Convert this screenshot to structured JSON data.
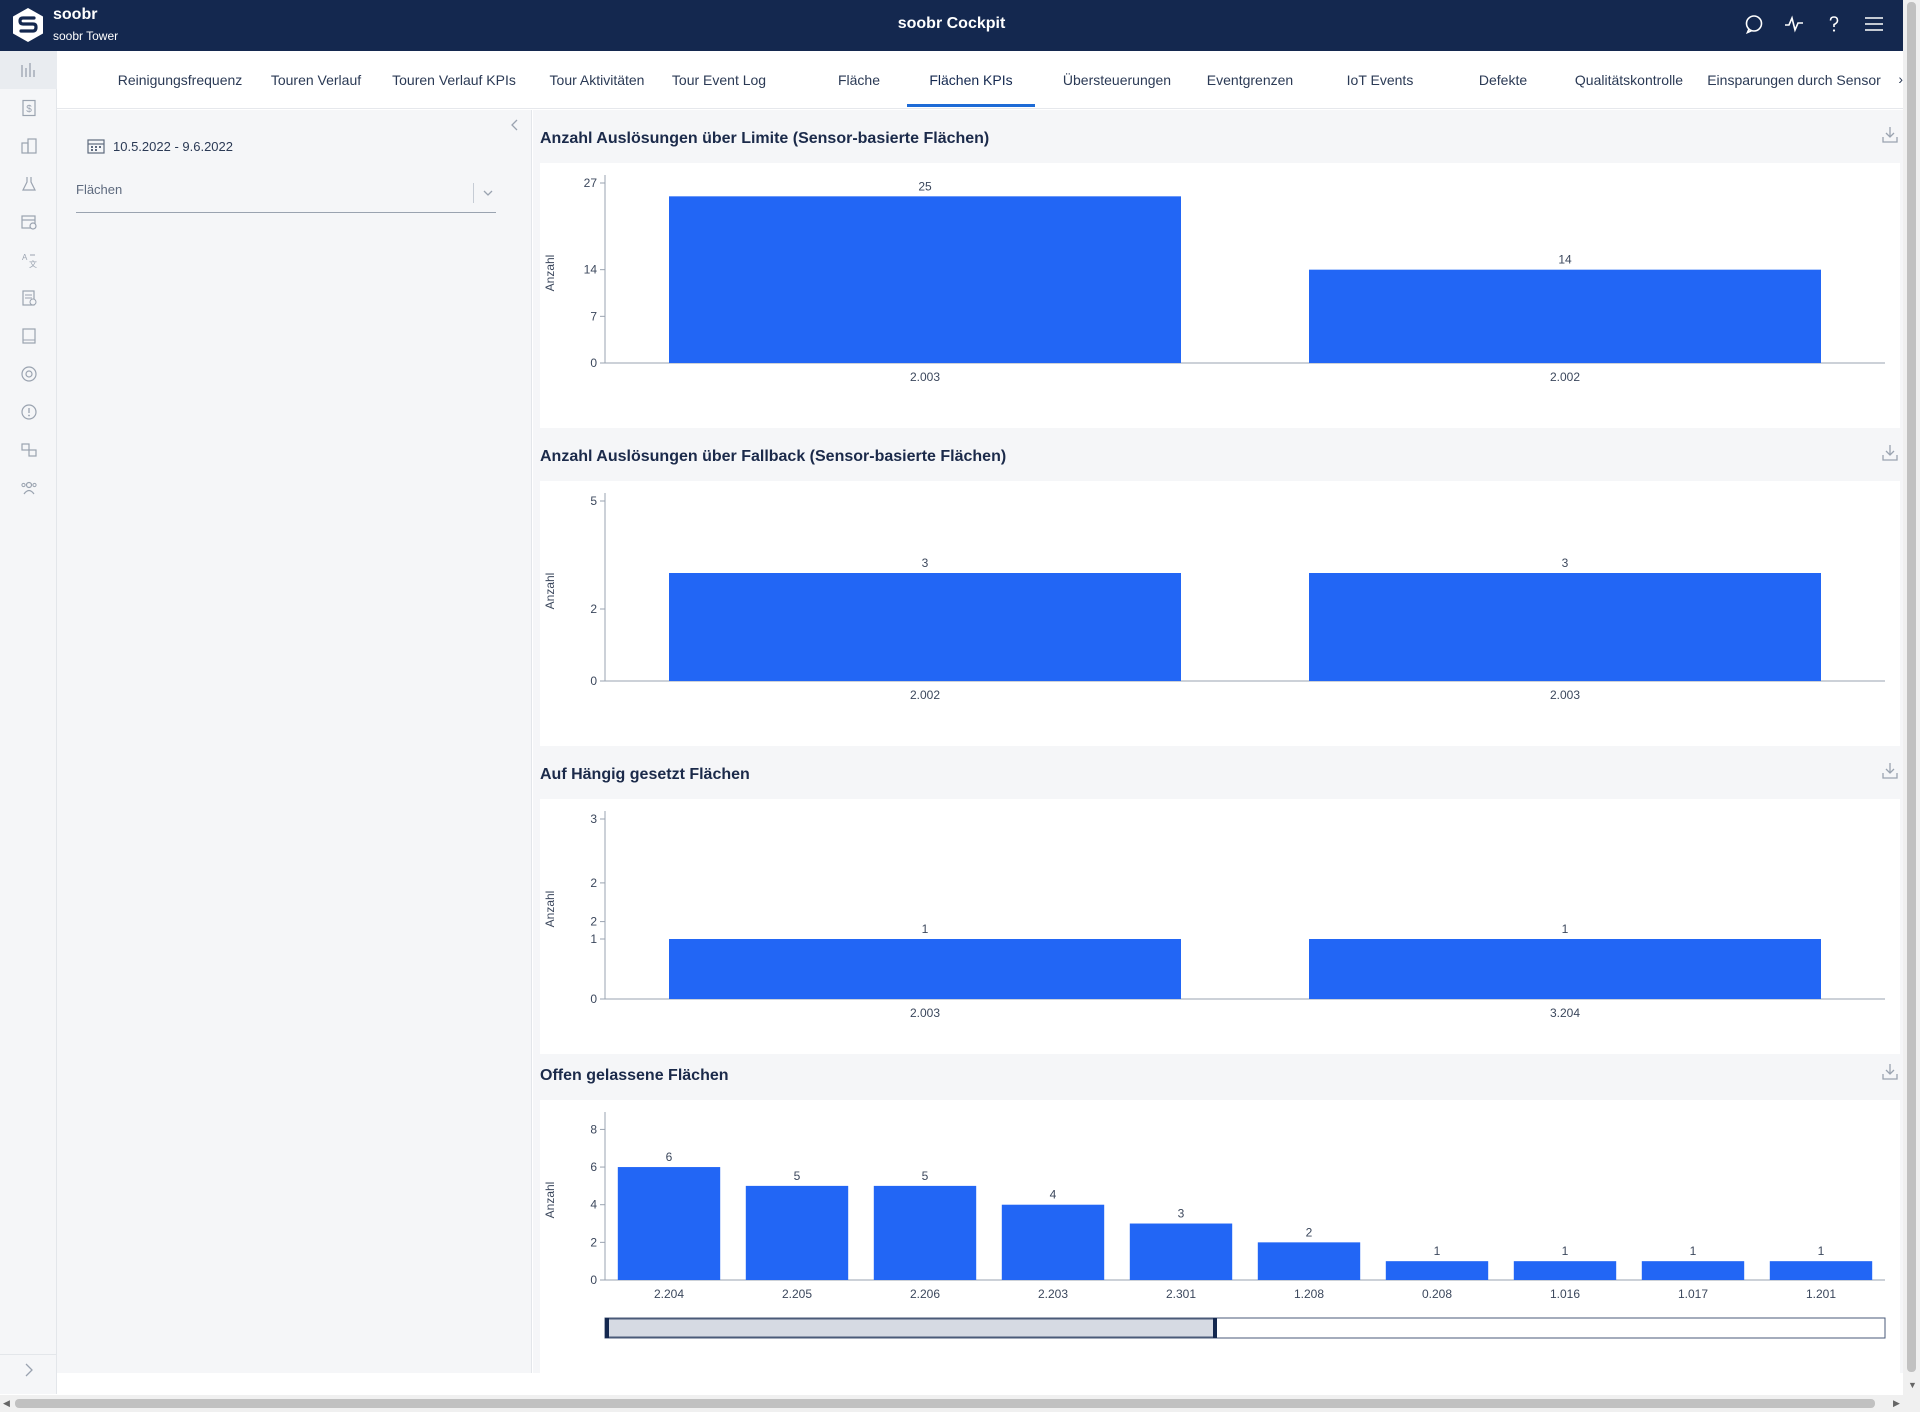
{
  "header": {
    "brand_name": "soobr",
    "brand_sub": "soobr Tower",
    "title": "soobr Cockpit",
    "icons": [
      "chat-icon",
      "activity-icon",
      "help-icon",
      "menu-icon"
    ]
  },
  "rail": {
    "items": [
      "bar-chart-icon",
      "dollar-icon",
      "building-icon",
      "flask-icon",
      "calendar-clock-icon",
      "translate-icon",
      "report-icon",
      "tablet-icon",
      "target-icon",
      "alert-icon",
      "swap-icon",
      "users-icon"
    ]
  },
  "tabs": [
    {
      "label": "Reinigungsfrequenz"
    },
    {
      "label": "Touren Verlauf"
    },
    {
      "label": "Touren Verlauf KPIs"
    },
    {
      "label": "Tour Aktivitäten"
    },
    {
      "label": "Tour Event Log"
    },
    {
      "label": "Fläche"
    },
    {
      "label": "Flächen KPIs"
    },
    {
      "label": "Übersteuerungen"
    },
    {
      "label": "Eventgrenzen"
    },
    {
      "label": "IoT Events"
    },
    {
      "label": "Defekte"
    },
    {
      "label": "Qualitätskontrolle"
    },
    {
      "label": "Einsparungen durch Sensor"
    }
  ],
  "active_tab": "Flächen KPIs",
  "filters": {
    "date_range": "10.5.2022 - 9.6.2022",
    "areas_label": "Flächen"
  },
  "colors": {
    "bar": "#2266f5",
    "header": "#14284f",
    "accent": "#1d6bd6"
  },
  "chart_data": [
    {
      "type": "bar",
      "title": "Anzahl Auslösungen über Limite (Sensor-basierte Flächen)",
      "ylabel": "Anzahl",
      "categories": [
        "2.003",
        "2.002"
      ],
      "values": [
        25,
        14
      ],
      "yticks": [
        "0",
        "7",
        "14",
        "27"
      ],
      "ylim": [
        0,
        27
      ]
    },
    {
      "type": "bar",
      "title": "Anzahl Auslösungen über Fallback (Sensor-basierte Flächen)",
      "ylabel": "Anzahl",
      "categories": [
        "2.002",
        "2.003"
      ],
      "values": [
        3,
        3
      ],
      "yticks": [
        "0",
        "2",
        "5"
      ],
      "ylim": [
        0,
        5
      ]
    },
    {
      "type": "bar",
      "title": "Auf Hängig gesetzt Flächen",
      "ylabel": "Anzahl",
      "categories": [
        "2.003",
        "3.204"
      ],
      "values": [
        1,
        1
      ],
      "yticks": [
        "0",
        "1",
        "2",
        "2",
        "3"
      ],
      "ylim": [
        0,
        3
      ]
    },
    {
      "type": "bar",
      "title": "Offen gelassene Flächen",
      "ylabel": "Anzahl",
      "categories": [
        "2.204",
        "2.205",
        "2.206",
        "2.203",
        "2.301",
        "1.208",
        "0.208",
        "1.016",
        "1.017",
        "1.201"
      ],
      "values": [
        6,
        5,
        5,
        4,
        3,
        2,
        1,
        1,
        1,
        1
      ],
      "yticks": [
        "0",
        "2",
        "4",
        "6",
        "8"
      ],
      "ylim": [
        0,
        8.5
      ]
    }
  ]
}
